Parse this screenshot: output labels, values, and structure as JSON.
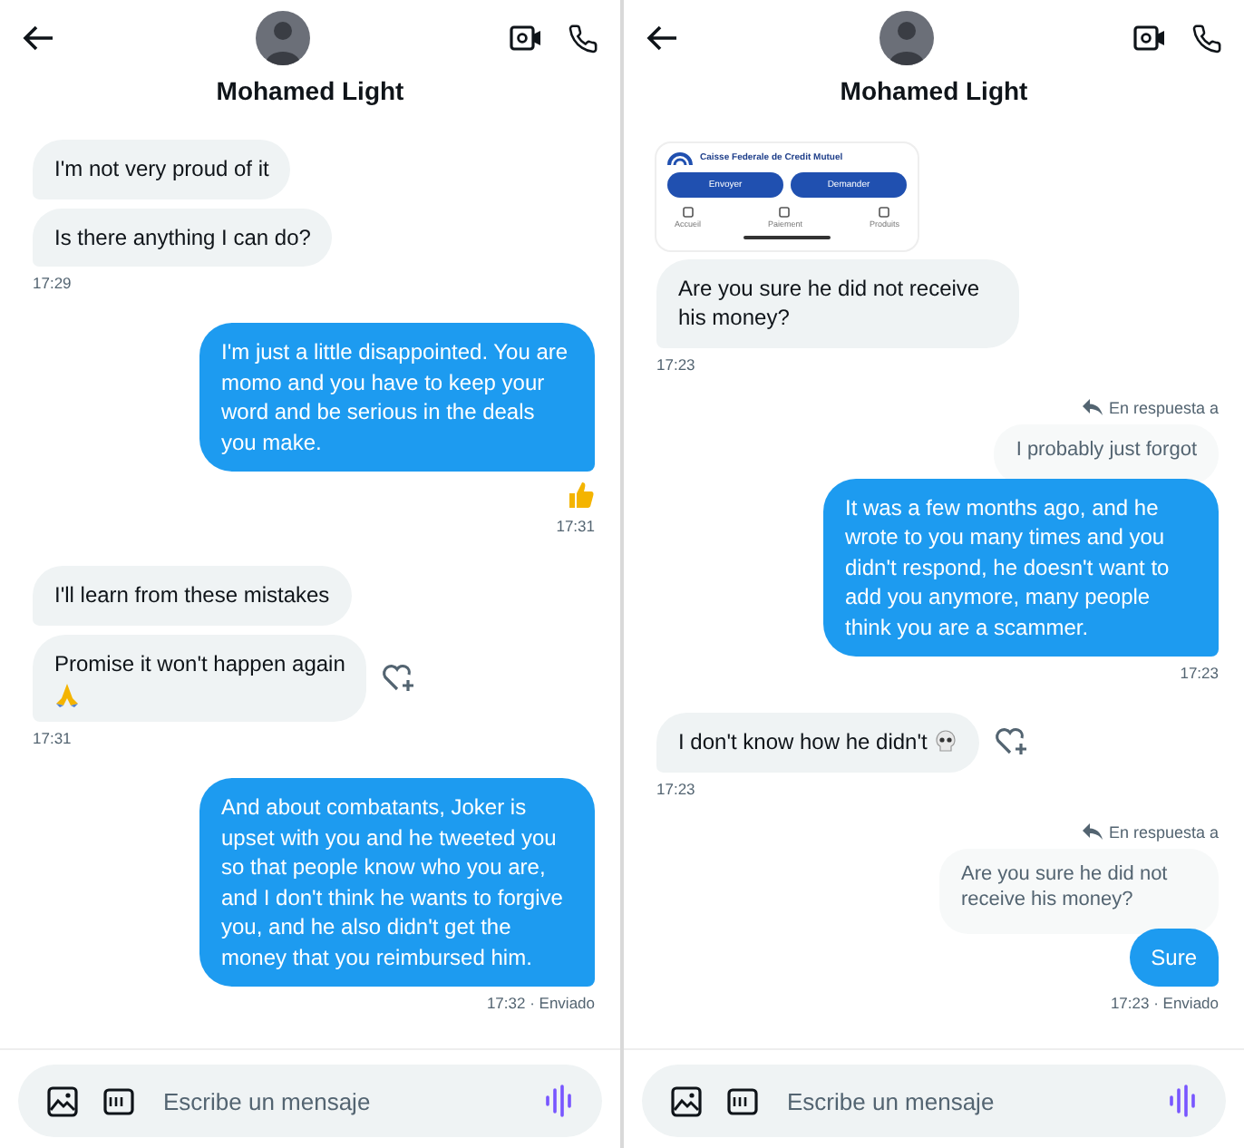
{
  "panels": [
    {
      "contact": {
        "name": "Mohamed Light"
      },
      "items": [
        {
          "kind": "bubble",
          "sent": false,
          "text": "I'm not very proud of it"
        },
        {
          "kind": "bubble",
          "sent": false,
          "text": "Is there anything I can do?"
        },
        {
          "kind": "time",
          "sent": false,
          "text": "17:29"
        },
        {
          "kind": "bubble",
          "sent": true,
          "text": "I'm just a little disappointed. You are momo and you have to keep your word and be serious in the deals you make."
        },
        {
          "kind": "reaction",
          "sent": true,
          "emoji": {
            "kind": "thumbs_up"
          }
        },
        {
          "kind": "time",
          "sent": true,
          "text": "17:31"
        },
        {
          "kind": "bubble",
          "sent": false,
          "text": "I'll learn from these mistakes"
        },
        {
          "kind": "bubble",
          "sent": false,
          "text": "Promise it won't happen again",
          "emoji": {
            "kind": "pray",
            "own_line": true
          },
          "add_reaction": true
        },
        {
          "kind": "time",
          "sent": false,
          "text": "17:31"
        },
        {
          "kind": "bubble",
          "sent": true,
          "text": "And about combatants, Joker is upset with you and he tweeted you so that people know who you are, and I don't think he wants to forgive you, and he also didn't get the money that you reimbursed him."
        },
        {
          "kind": "time",
          "sent": true,
          "text": "17:32 · Enviado"
        }
      ],
      "composer": {
        "placeholder": "Escribe un mensaje"
      }
    },
    {
      "contact": {
        "name": "Mohamed Light"
      },
      "items": [
        {
          "kind": "image",
          "sent": false,
          "app": {
            "bank": "Caisse Federale de Credit Mutuel",
            "buttons": [
              "Envoyer",
              "Demander"
            ],
            "tabs": [
              "Accueil",
              "Paiement",
              "Produits"
            ]
          }
        },
        {
          "kind": "bubble",
          "sent": false,
          "text": "Are you sure he did not receive his money?"
        },
        {
          "kind": "time",
          "sent": false,
          "text": "17:23"
        },
        {
          "kind": "reply",
          "sent": true,
          "label": "En respuesta a",
          "quote": "I probably just forgot"
        },
        {
          "kind": "bubble",
          "sent": true,
          "text": "It was a few months ago, and he wrote to you many times and you didn't respond, he doesn't want to add you anymore, many people think you are a scammer."
        },
        {
          "kind": "time",
          "sent": true,
          "text": "17:23"
        },
        {
          "kind": "bubble",
          "sent": false,
          "text": "I don't know how he didn't",
          "emoji": {
            "kind": "skull",
            "own_line": false
          },
          "add_reaction": true
        },
        {
          "kind": "time",
          "sent": false,
          "text": "17:23"
        },
        {
          "kind": "reply",
          "sent": true,
          "label": "En respuesta a",
          "quote": "Are you sure he did not receive his money?"
        },
        {
          "kind": "bubble",
          "sent": true,
          "text": "Sure"
        },
        {
          "kind": "time",
          "sent": true,
          "text": "17:23 · Enviado"
        }
      ],
      "composer": {
        "placeholder": "Escribe un mensaje"
      }
    }
  ]
}
